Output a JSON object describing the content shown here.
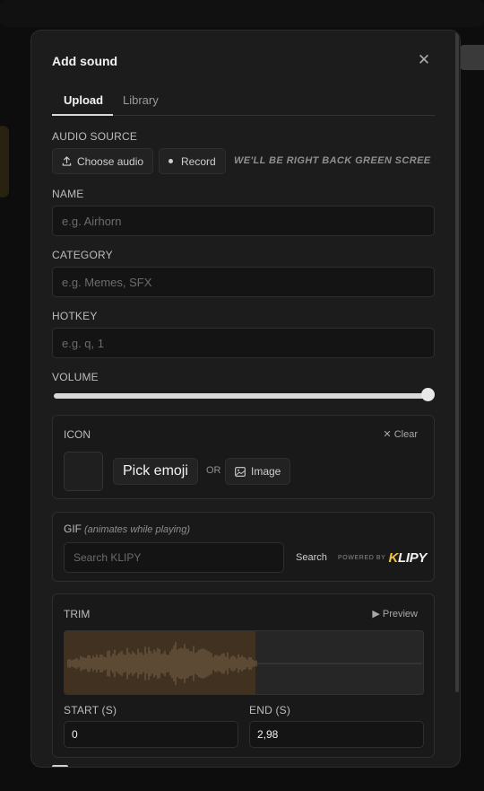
{
  "dialog": {
    "title": "Add sound",
    "close_icon": "close-icon"
  },
  "tabs": [
    {
      "label": "Upload",
      "active": true
    },
    {
      "label": "Library",
      "active": false
    }
  ],
  "audio_source": {
    "label": "AUDIO SOURCE",
    "choose_label": "Choose audio",
    "choose_icon": "upload-icon",
    "record_label": "Record",
    "record_icon": "record-dot-icon",
    "file_name": "WE'LL BE RIGHT BACK GREEN SCREEN...."
  },
  "name": {
    "label": "NAME",
    "placeholder": "e.g. Airhorn",
    "value": ""
  },
  "category": {
    "label": "CATEGORY",
    "placeholder": "e.g. Memes, SFX",
    "value": ""
  },
  "hotkey": {
    "label": "HOTKEY",
    "placeholder": "e.g. q, 1",
    "value": ""
  },
  "volume": {
    "label": "VOLUME",
    "level": 1.0
  },
  "icon": {
    "label": "ICON",
    "clear_label": "Clear",
    "pick_emoji_label": "Pick emoji",
    "or_label": "OR",
    "image_label": "Image",
    "image_icon": "image-icon"
  },
  "gif": {
    "label": "GIF",
    "hint": "(animates while playing)",
    "search_placeholder": "Search KLIPY",
    "search_label": "Search",
    "powered_by": "POWERED BY",
    "brand": "KLIPY"
  },
  "trim": {
    "label": "TRIM",
    "preview_label": "Preview",
    "start_label": "START (S)",
    "end_label": "END (S)",
    "start_value": "0",
    "end_value": "2,98"
  },
  "colors": {
    "background": "#1c1c1c",
    "accent_selection": "#403121",
    "brand_yellow": "#f0c33a"
  }
}
